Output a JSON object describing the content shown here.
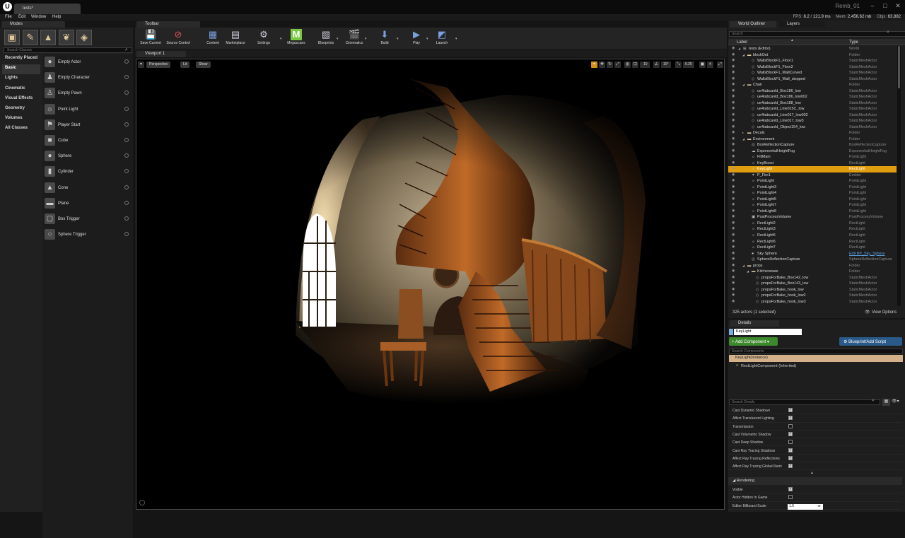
{
  "window": {
    "doc_tab": "tests*",
    "project": "Remb_01",
    "controls": [
      "–",
      "□",
      "✕"
    ]
  },
  "menu": [
    "File",
    "Edit",
    "Window",
    "Help"
  ],
  "stats": {
    "fps_label": "FPS:",
    "fps": "8.2",
    "ms": "121.9 ms",
    "mem_label": "Mem:",
    "mem": "2,456.62 mb",
    "objs_label": "Objs:",
    "objs": "63,882"
  },
  "modes": {
    "tab": "Modes",
    "search_placeholder": "Search Classes",
    "categories": [
      "Recently Placed",
      "Basic",
      "Lights",
      "Cinematic",
      "Visual Effects",
      "Geometry",
      "Volumes",
      "All Classes"
    ],
    "selected_category": "Basic",
    "items": [
      {
        "label": "Empty Actor",
        "icon": "●"
      },
      {
        "label": "Empty Character",
        "icon": "♟"
      },
      {
        "label": "Empty Pawn",
        "icon": "♙"
      },
      {
        "label": "Point Light",
        "icon": "☼"
      },
      {
        "label": "Player Start",
        "icon": "⚑"
      },
      {
        "label": "Cube",
        "icon": "■"
      },
      {
        "label": "Sphere",
        "icon": "●"
      },
      {
        "label": "Cylinder",
        "icon": "▮"
      },
      {
        "label": "Cone",
        "icon": "▲"
      },
      {
        "label": "Plane",
        "icon": "▬"
      },
      {
        "label": "Box Trigger",
        "icon": "▢"
      },
      {
        "label": "Sphere Trigger",
        "icon": "○"
      }
    ]
  },
  "toolbar": {
    "tab": "Toolbar",
    "buttons": [
      {
        "label": "Save Current",
        "icon": "💾"
      },
      {
        "label": "Source Control",
        "icon": "⊘"
      },
      {
        "label": "Content",
        "icon": "▦"
      },
      {
        "label": "Marketplace",
        "icon": "▤"
      },
      {
        "label": "Settings",
        "icon": "⚙"
      },
      {
        "label": "Megascans",
        "icon": "M"
      },
      {
        "label": "Blueprints",
        "icon": "▧"
      },
      {
        "label": "Cinematics",
        "icon": "🎬"
      },
      {
        "label": "Build",
        "icon": "⬇"
      },
      {
        "label": "Play",
        "icon": "▶"
      },
      {
        "label": "Launch",
        "icon": "◩"
      }
    ]
  },
  "viewport": {
    "tab": "Viewport 1",
    "perspective": "Perspective",
    "lit": "Lit",
    "show": "Show",
    "grid_snap": "10",
    "rot_snap": "10°",
    "scale_snap": "0.25",
    "cam_speed": "4"
  },
  "outliner": {
    "tabs": [
      "World Outliner",
      "Layers"
    ],
    "search_placeholder": "Search",
    "col_label": "Label",
    "col_type": "Type",
    "rows": [
      {
        "indent": 0,
        "arrow": "◢",
        "icon": "⊞",
        "name": "tests (Editor)",
        "type": "World"
      },
      {
        "indent": 1,
        "arrow": "◢",
        "icon": "▬",
        "name": "blockOut",
        "type": "Folder"
      },
      {
        "indent": 2,
        "arrow": "",
        "icon": "◇",
        "name": "WallsBlockF1_Floor1",
        "type": "StaticMeshActor"
      },
      {
        "indent": 2,
        "arrow": "",
        "icon": "◇",
        "name": "WallsBlockF1_Floor2",
        "type": "StaticMeshActor"
      },
      {
        "indent": 2,
        "arrow": "",
        "icon": "◇",
        "name": "WallsBlockF1_WallCurved",
        "type": "StaticMeshActor"
      },
      {
        "indent": 2,
        "arrow": "",
        "icon": "◇",
        "name": "WallsBlockF1_Wall_stepped",
        "type": "StaticMeshActor"
      },
      {
        "indent": 1,
        "arrow": "◢",
        "icon": "▬",
        "name": "Chair",
        "type": "Folder"
      },
      {
        "indent": 2,
        "arrow": "",
        "icon": "◇",
        "name": "ue4tabcanld_Box186_low",
        "type": "StaticMeshActor"
      },
      {
        "indent": 2,
        "arrow": "",
        "icon": "◇",
        "name": "ue4tabcanld_Box186_low002",
        "type": "StaticMeshActor"
      },
      {
        "indent": 2,
        "arrow": "",
        "icon": "◇",
        "name": "ue4tabcanld_Box188_low",
        "type": "StaticMeshActor"
      },
      {
        "indent": 2,
        "arrow": "",
        "icon": "◇",
        "name": "ue4tabcanld_Line015C_low",
        "type": "StaticMeshActor"
      },
      {
        "indent": 2,
        "arrow": "",
        "icon": "◇",
        "name": "ue4tabcanld_Line017_low002",
        "type": "StaticMeshActor"
      },
      {
        "indent": 2,
        "arrow": "",
        "icon": "◇",
        "name": "ue4tabcanld_Line017_low3",
        "type": "StaticMeshActor"
      },
      {
        "indent": 2,
        "arrow": "",
        "icon": "◇",
        "name": "ue4tabcanld_Object154_low",
        "type": "StaticMeshActor"
      },
      {
        "indent": 1,
        "arrow": "▸",
        "icon": "▬",
        "name": "Decals",
        "type": "Folder"
      },
      {
        "indent": 1,
        "arrow": "◢",
        "icon": "▬",
        "name": "Environment",
        "type": "Folder"
      },
      {
        "indent": 2,
        "arrow": "",
        "icon": "◎",
        "name": "BoxReflectionCapture",
        "type": "BoxReflectionCapture"
      },
      {
        "indent": 2,
        "arrow": "",
        "icon": "☁",
        "name": "ExponentialHeightFog",
        "type": "ExponentialHeightFog"
      },
      {
        "indent": 2,
        "arrow": "",
        "icon": "☼",
        "name": "FillMain",
        "type": "PointLight"
      },
      {
        "indent": 2,
        "arrow": "",
        "icon": "☼",
        "name": "KeyBoost",
        "type": "RectLight"
      },
      {
        "indent": 2,
        "arrow": "",
        "icon": "☼",
        "name": "KeyLight",
        "type": "RectLight",
        "selected": true
      },
      {
        "indent": 2,
        "arrow": "",
        "icon": "✦",
        "name": "P_Fire1",
        "type": "Emitter"
      },
      {
        "indent": 2,
        "arrow": "",
        "icon": "☼",
        "name": "PointLight",
        "type": "PointLight"
      },
      {
        "indent": 2,
        "arrow": "",
        "icon": "☼",
        "name": "PointLight3",
        "type": "PointLight"
      },
      {
        "indent": 2,
        "arrow": "",
        "icon": "☼",
        "name": "PointLight4",
        "type": "PointLight"
      },
      {
        "indent": 2,
        "arrow": "",
        "icon": "☼",
        "name": "PointLight5",
        "type": "PointLight"
      },
      {
        "indent": 2,
        "arrow": "",
        "icon": "☼",
        "name": "PointLight7",
        "type": "PointLight"
      },
      {
        "indent": 2,
        "arrow": "",
        "icon": "☼",
        "name": "PointLight8",
        "type": "PointLight"
      },
      {
        "indent": 2,
        "arrow": "",
        "icon": "▣",
        "name": "PostProcessVolume",
        "type": "PostProcessVolume"
      },
      {
        "indent": 2,
        "arrow": "",
        "icon": "☼",
        "name": "RectLight2",
        "type": "RectLight"
      },
      {
        "indent": 2,
        "arrow": "",
        "icon": "☼",
        "name": "RectLight3",
        "type": "RectLight"
      },
      {
        "indent": 2,
        "arrow": "",
        "icon": "☼",
        "name": "RectLight5",
        "type": "RectLight"
      },
      {
        "indent": 2,
        "arrow": "",
        "icon": "☼",
        "name": "RectLight6",
        "type": "RectLight"
      },
      {
        "indent": 2,
        "arrow": "",
        "icon": "☼",
        "name": "RectLight7",
        "type": "RectLight"
      },
      {
        "indent": 2,
        "arrow": "",
        "icon": "●",
        "name": "Sky Sphere",
        "type": "Edit BP_Sky_Sphere",
        "link": true
      },
      {
        "indent": 2,
        "arrow": "",
        "icon": "◎",
        "name": "SphereReflectionCapture",
        "type": "SphereReflectionCapture"
      },
      {
        "indent": 1,
        "arrow": "◢",
        "icon": "▬",
        "name": "props",
        "type": "Folder"
      },
      {
        "indent": 2,
        "arrow": "◢",
        "icon": "▬",
        "name": "Kitchenware",
        "type": "Folder"
      },
      {
        "indent": 3,
        "arrow": "",
        "icon": "◇",
        "name": "propsForBake_Box142_low",
        "type": "StaticMeshActor"
      },
      {
        "indent": 3,
        "arrow": "",
        "icon": "◇",
        "name": "propsForBake_Box143_low",
        "type": "StaticMeshActor"
      },
      {
        "indent": 3,
        "arrow": "",
        "icon": "◇",
        "name": "propsForBake_hook_low",
        "type": "StaticMeshActor"
      },
      {
        "indent": 3,
        "arrow": "",
        "icon": "◇",
        "name": "propsForBake_hook_low2",
        "type": "StaticMeshActor"
      },
      {
        "indent": 3,
        "arrow": "",
        "icon": "◇",
        "name": "propsForBake_hook_low3",
        "type": "StaticMeshActor"
      }
    ],
    "actor_count": "325 actors (1 selected)",
    "view_options": "View Options"
  },
  "details": {
    "tab": "Details",
    "name_value": "KeyLight",
    "add_component": "+ Add Component ▾",
    "blueprint_button": "Blueprint/Add Script",
    "comp_search_placeholder": "Search Components",
    "component_instance": "KeyLight(Instance)",
    "component_inherited": "RectLightComponent (Inherited)",
    "details_search_placeholder": "Search Details",
    "props": [
      {
        "label": "Cast Dynamic Shadows",
        "checked": true
      },
      {
        "label": "Affect Translucent Lighting",
        "checked": true
      },
      {
        "label": "Transmission",
        "checked": false
      },
      {
        "label": "Cast Volumetric Shadow",
        "checked": true
      },
      {
        "label": "Cast Deep Shadow",
        "checked": false
      },
      {
        "label": "Cast Ray Tracing Shadows",
        "checked": true
      },
      {
        "label": "Affect Ray Tracing Reflections",
        "checked": true
      },
      {
        "label": "Affect Ray Tracing Global Illumi",
        "checked": true
      }
    ],
    "section_rendering": "Rendering",
    "render_props": [
      {
        "label": "Visible",
        "checked": true
      },
      {
        "label": "Actor Hidden In Game",
        "checked": false
      }
    ],
    "billboard_label": "Editor Billboard Scale",
    "billboard_value": "1.0"
  }
}
